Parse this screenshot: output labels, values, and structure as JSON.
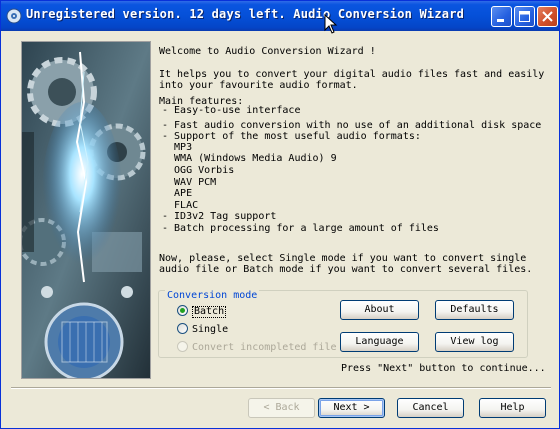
{
  "window": {
    "title": "Unregistered version. 12 days left. Audio Conversion Wizard"
  },
  "intro": {
    "welcome": "Welcome to Audio Conversion Wizard !",
    "desc_line1": "It helps you to convert your digital audio files fast and easily",
    "desc_line2": "into your favourite audio format.",
    "features_heading": "Main features:",
    "features": [
      "- Easy-to-use interface",
      "- Fast audio conversion with no use of an additional disk space",
      "- Support of the most useful audio formats:",
      "  MP3",
      "  WMA (Windows Media Audio) 9",
      "  OGG Vorbis",
      "  WAV PCM",
      "  APE",
      "  FLAC",
      "- ID3v2 Tag support",
      "- Batch processing for a large amount of files"
    ],
    "select_line1": "Now, please, select Single mode if you want to convert single",
    "select_line2": "audio file or Batch mode if you want to convert several files."
  },
  "conversion_mode": {
    "label": "Conversion mode",
    "options": [
      {
        "label": "Batch",
        "selected": true,
        "enabled": true
      },
      {
        "label": "Single",
        "selected": false,
        "enabled": true
      },
      {
        "label": "Convert incompleted file",
        "selected": false,
        "enabled": false
      }
    ]
  },
  "buttons": {
    "about": "About",
    "defaults": "Defaults",
    "language": "Language",
    "view_log": "View log"
  },
  "hint": "Press \"Next\" button to continue...",
  "nav": {
    "back": "< Back",
    "next": "Next >",
    "cancel": "Cancel",
    "help": "Help"
  },
  "colors": {
    "titlebar": "#0550D8",
    "window_bg": "#ECE9D8",
    "group_label": "#0046D5",
    "radio_dot": "#21A121"
  },
  "icons": [
    "app-icon",
    "minimize-icon",
    "maximize-icon",
    "close-icon",
    "mouse-cursor-icon",
    "decorative-banner"
  ]
}
